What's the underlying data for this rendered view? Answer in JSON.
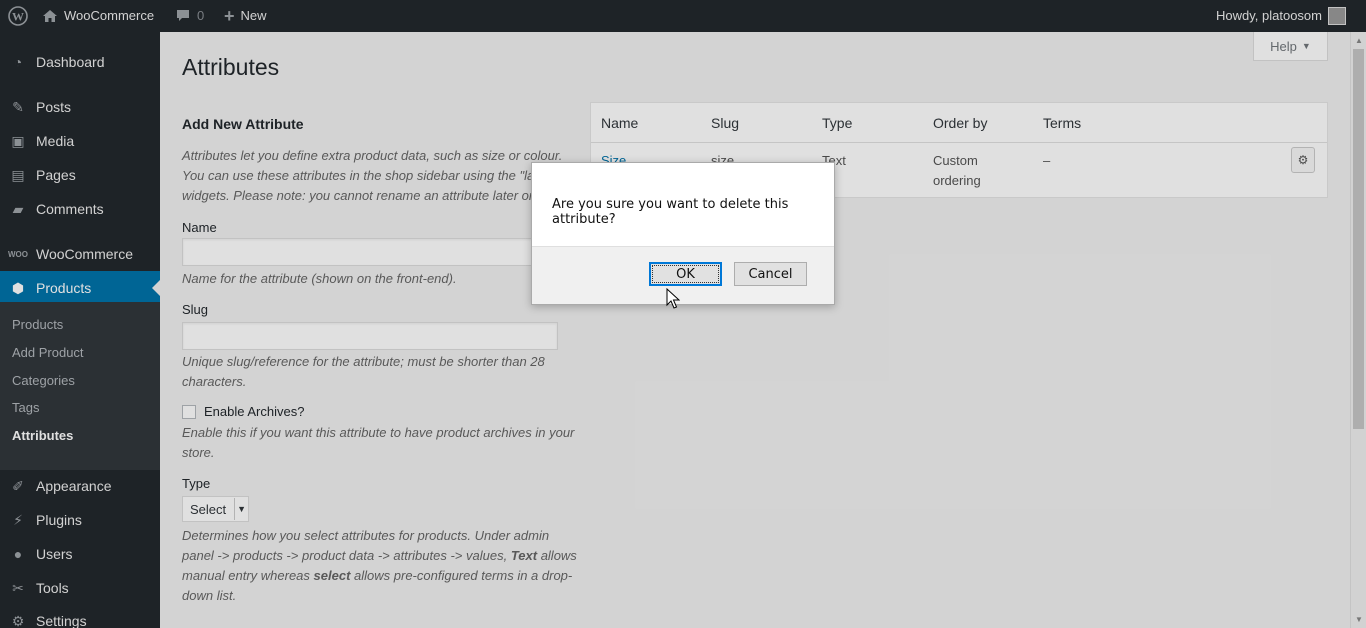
{
  "adminbar": {
    "site_name": "WooCommerce",
    "comments_count": "0",
    "new_label": "New",
    "howdy": "Howdy, platoosom"
  },
  "sidebar": {
    "items": [
      {
        "label": "Dashboard",
        "icon": "dashboard-icon"
      },
      {
        "label": "Posts",
        "icon": "pin-icon"
      },
      {
        "label": "Media",
        "icon": "media-icon"
      },
      {
        "label": "Pages",
        "icon": "pages-icon"
      },
      {
        "label": "Comments",
        "icon": "comment-icon"
      },
      {
        "label": "WooCommerce",
        "icon": "woo-icon"
      },
      {
        "label": "Products",
        "icon": "products-icon"
      },
      {
        "label": "Appearance",
        "icon": "brush-icon"
      },
      {
        "label": "Plugins",
        "icon": "plugin-icon"
      },
      {
        "label": "Users",
        "icon": "users-icon"
      },
      {
        "label": "Tools",
        "icon": "wrench-icon"
      },
      {
        "label": "Settings",
        "icon": "settings-icon"
      }
    ],
    "submenu": [
      "Products",
      "Add Product",
      "Categories",
      "Tags",
      "Attributes"
    ]
  },
  "page": {
    "title": "Attributes",
    "help_label": "Help"
  },
  "form": {
    "heading": "Add New Attribute",
    "intro": "Attributes let you define extra product data, such as size or colour. You can use these attributes in the shop sidebar using the \"layered n",
    "intro2": "widgets. Please note: you cannot rename an attribute later on.",
    "name_label": "Name",
    "name_desc": "Name for the attribute (shown on the front-end).",
    "slug_label": "Slug",
    "slug_desc": "Unique slug/reference for the attribute; must be shorter than 28 characters.",
    "archives_label": "Enable Archives?",
    "archives_desc": "Enable this if you want this attribute to have product archives in your store.",
    "type_label": "Type",
    "type_value": "Select",
    "type_desc_1": "Determines how you select attributes for products. Under admin panel -> products -> product data -> attributes -> values,",
    "type_desc_text": "Text",
    "type_desc_2": "allows manual entry whereas",
    "type_desc_select": "select",
    "type_desc_3": "allows pre-configured terms in a drop-down list."
  },
  "table": {
    "headers": [
      "Name",
      "Slug",
      "Type",
      "Order by",
      "Terms"
    ],
    "row": {
      "name": "Size",
      "slug": "size",
      "type": "Text",
      "order_by": "Custom ordering",
      "terms": "–"
    }
  },
  "dialog": {
    "message": "Are you sure you want to delete this attribute?",
    "ok_label": "OK",
    "cancel_label": "Cancel"
  },
  "colors": {
    "admin_bg": "#23282d",
    "accent": "#0073aa",
    "page_bg": "#f1f1f1"
  }
}
